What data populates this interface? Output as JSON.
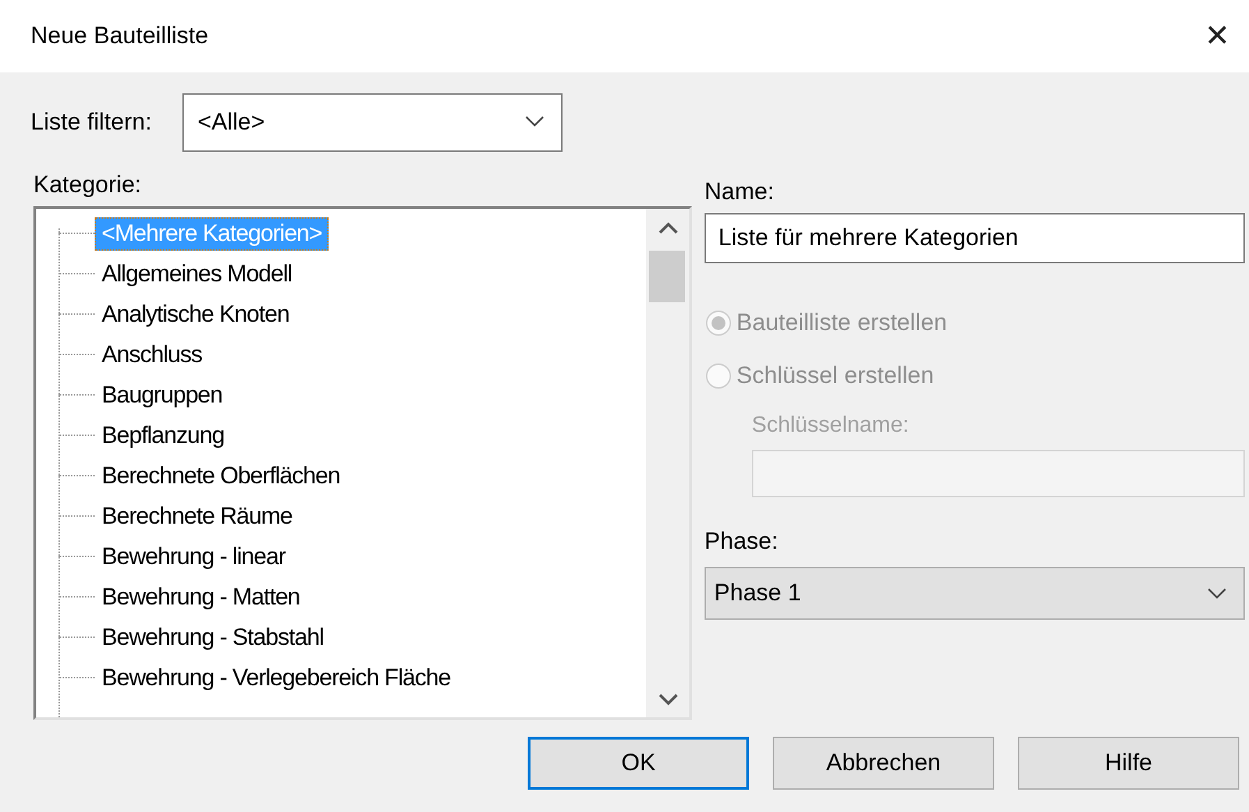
{
  "window": {
    "title": "Neue Bauteilliste",
    "close": "✕"
  },
  "filter": {
    "label": "Liste filtern:",
    "value": "<Alle>"
  },
  "category": {
    "label": "Kategorie:",
    "items": [
      {
        "label": "<Mehrere Kategorien>",
        "selected": true
      },
      {
        "label": "Allgemeines Modell",
        "selected": false
      },
      {
        "label": "Analytische Knoten",
        "selected": false
      },
      {
        "label": "Anschluss",
        "selected": false
      },
      {
        "label": "Baugruppen",
        "selected": false
      },
      {
        "label": "Bepflanzung",
        "selected": false
      },
      {
        "label": "Berechnete Oberflächen",
        "selected": false
      },
      {
        "label": "Berechnete Räume",
        "selected": false
      },
      {
        "label": "Bewehrung - linear",
        "selected": false
      },
      {
        "label": "Bewehrung - Matten",
        "selected": false
      },
      {
        "label": "Bewehrung - Stabstahl",
        "selected": false
      },
      {
        "label": "Bewehrung - Verlegebereich Fläche",
        "selected": false
      }
    ]
  },
  "name": {
    "label": "Name:",
    "value": "Liste für mehrere Kategorien"
  },
  "options": [
    {
      "label": "Bauteilliste erstellen",
      "selected": true,
      "disabled": true
    },
    {
      "label": "Schlüssel erstellen",
      "selected": false,
      "disabled": true
    }
  ],
  "key_name": {
    "label": "Schlüsselname:",
    "disabled": true
  },
  "phase": {
    "label": "Phase:",
    "value": "Phase 1"
  },
  "buttons": [
    {
      "label": "OK",
      "default": true
    },
    {
      "label": "Abbrechen",
      "default": false
    },
    {
      "label": "Hilfe",
      "default": false
    }
  ]
}
